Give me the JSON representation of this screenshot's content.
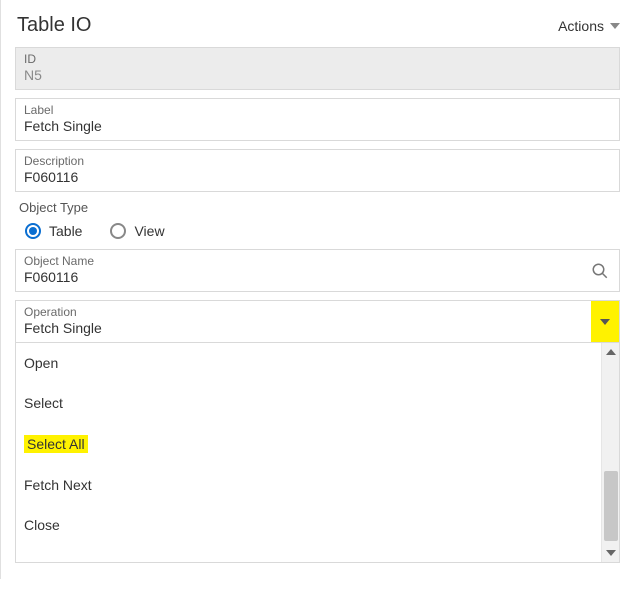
{
  "header": {
    "title": "Table IO",
    "actions_label": "Actions"
  },
  "fields": {
    "id": {
      "label": "ID",
      "value": "N5"
    },
    "label": {
      "label": "Label",
      "value": "Fetch Single"
    },
    "description": {
      "label": "Description",
      "value": "F060116"
    },
    "object_type": {
      "label": "Object Type",
      "options": {
        "table": "Table",
        "view": "View"
      },
      "selected": "Table"
    },
    "object_name": {
      "label": "Object Name",
      "value": "F060116"
    },
    "operation": {
      "label": "Operation",
      "value": "Fetch Single"
    }
  },
  "dropdown": {
    "items": [
      "Open",
      "Select",
      "Select All",
      "Fetch Next",
      "Close"
    ],
    "highlighted": "Select All"
  }
}
